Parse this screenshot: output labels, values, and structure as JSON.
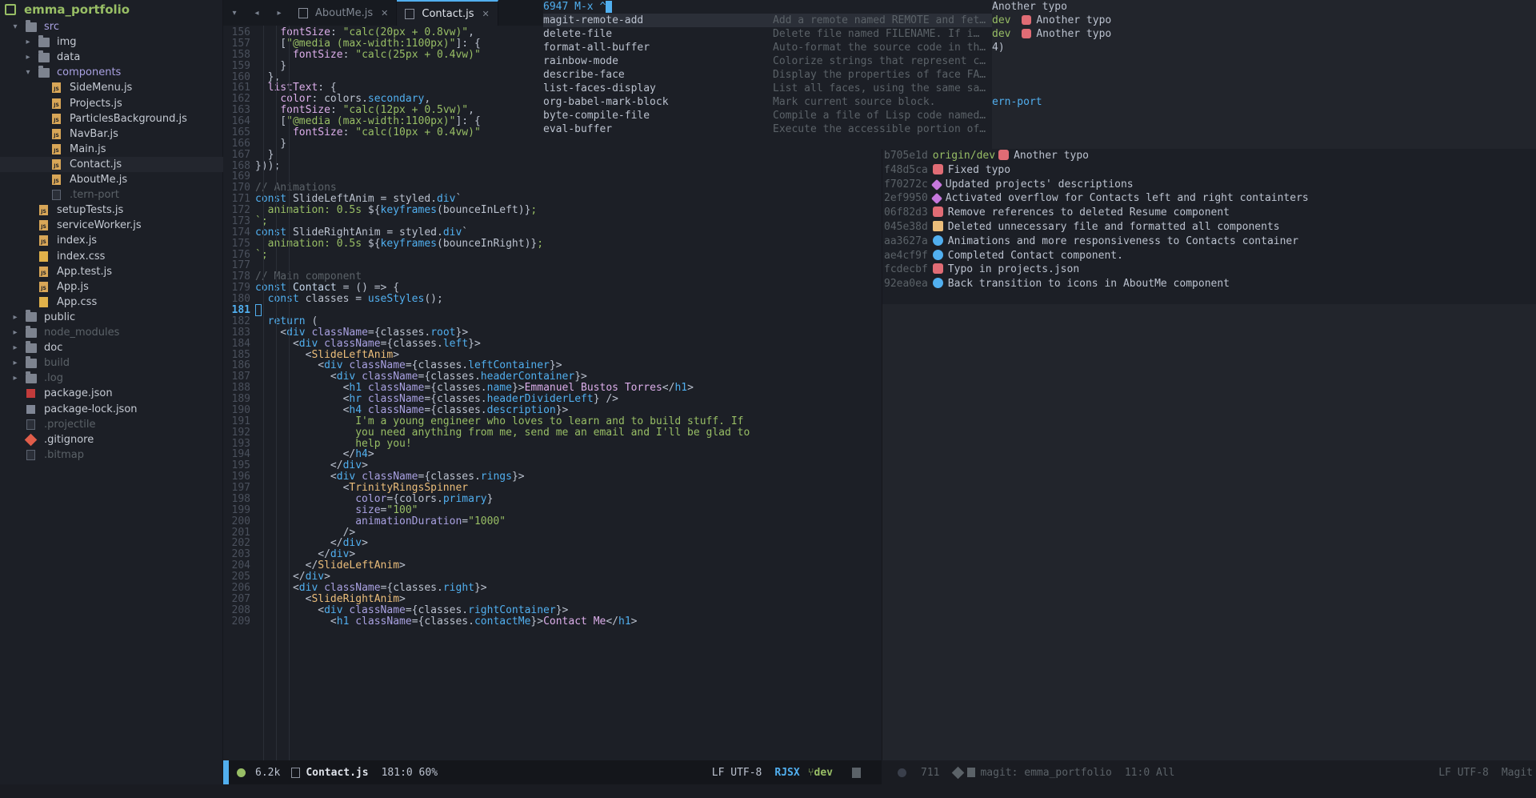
{
  "sidebar": {
    "project": "emma_portfolio",
    "items": [
      {
        "label": "src",
        "kind": "folder-open",
        "depth": 0,
        "color": "#a9a1e1"
      },
      {
        "label": "img",
        "kind": "folder",
        "depth": 1,
        "color": "#c5cad3"
      },
      {
        "label": "data",
        "kind": "folder",
        "depth": 1,
        "color": "#c5cad3"
      },
      {
        "label": "components",
        "kind": "folder-open",
        "depth": 1,
        "color": "#a9a1e1"
      },
      {
        "label": "SideMenu.js",
        "kind": "js",
        "depth": 2,
        "color": "#c5cad3"
      },
      {
        "label": "Projects.js",
        "kind": "js",
        "depth": 2,
        "color": "#c5cad3"
      },
      {
        "label": "ParticlesBackground.js",
        "kind": "js",
        "depth": 2,
        "color": "#c5cad3"
      },
      {
        "label": "NavBar.js",
        "kind": "js",
        "depth": 2,
        "color": "#c5cad3"
      },
      {
        "label": "Main.js",
        "kind": "js",
        "depth": 2,
        "color": "#c5cad3"
      },
      {
        "label": "Contact.js",
        "kind": "js",
        "depth": 2,
        "color": "#c5cad3",
        "selected": true
      },
      {
        "label": "AboutMe.js",
        "kind": "js",
        "depth": 2,
        "color": "#c5cad3"
      },
      {
        "label": ".tern-port",
        "kind": "doc",
        "depth": 2,
        "color": "#5b6268"
      },
      {
        "label": "setupTests.js",
        "kind": "js",
        "depth": 1,
        "color": "#c5cad3"
      },
      {
        "label": "serviceWorker.js",
        "kind": "js",
        "depth": 1,
        "color": "#c5cad3"
      },
      {
        "label": "index.js",
        "kind": "js",
        "depth": 1,
        "color": "#c5cad3"
      },
      {
        "label": "index.css",
        "kind": "css",
        "depth": 1,
        "color": "#c5cad3"
      },
      {
        "label": "App.test.js",
        "kind": "js",
        "depth": 1,
        "color": "#c5cad3"
      },
      {
        "label": "App.js",
        "kind": "js",
        "depth": 1,
        "color": "#c5cad3"
      },
      {
        "label": "App.css",
        "kind": "css",
        "depth": 1,
        "color": "#c5cad3"
      },
      {
        "label": "public",
        "kind": "folder",
        "depth": 0,
        "color": "#c5cad3"
      },
      {
        "label": "node_modules",
        "kind": "folder",
        "depth": 0,
        "color": "#5b6268"
      },
      {
        "label": "doc",
        "kind": "folder",
        "depth": 0,
        "color": "#c5cad3"
      },
      {
        "label": "build",
        "kind": "folder",
        "depth": 0,
        "color": "#5b6268"
      },
      {
        "label": ".log",
        "kind": "folder",
        "depth": 0,
        "color": "#5b6268"
      },
      {
        "label": "package.json",
        "kind": "npm",
        "depth": 0,
        "color": "#c5cad3"
      },
      {
        "label": "package-lock.json",
        "kind": "lock",
        "depth": 0,
        "color": "#c5cad3"
      },
      {
        "label": ".projectile",
        "kind": "doc",
        "depth": 0,
        "color": "#5b6268"
      },
      {
        "label": ".gitignore",
        "kind": "git",
        "depth": 0,
        "color": "#c5cad3"
      },
      {
        "label": ".bitmap",
        "kind": "doc",
        "depth": 0,
        "color": "#5b6268"
      }
    ]
  },
  "tabs": [
    {
      "label": "AboutMe.js",
      "active": false
    },
    {
      "label": "Contact.js",
      "active": true
    }
  ],
  "code": {
    "current_line": 181,
    "lines": [
      {
        "n": 156,
        "html": "    <span class='v'>fontSize</span>: <span class='s'>\"calc(20px + 0.8vw)\"</span>,"
      },
      {
        "n": 157,
        "html": "    [<span class='s'>\"@media (max-width:1100px)\"</span>]: {"
      },
      {
        "n": 158,
        "html": "      <span class='v'>fontSize</span>: <span class='s'>\"calc(25px + 0.4vw)\"</span>"
      },
      {
        "n": 159,
        "html": "    }"
      },
      {
        "n": 160,
        "html": "  },"
      },
      {
        "n": 161,
        "html": "  <span class='v'>listText</span>: {"
      },
      {
        "n": 162,
        "html": "    <span class='v'>color</span>: colors.<span class='k'>secondary</span>,"
      },
      {
        "n": 163,
        "html": "    <span class='v'>fontSize</span>: <span class='s'>\"calc(12px + 0.5vw)\"</span>,"
      },
      {
        "n": 164,
        "html": "    [<span class='s'>\"@media (max-width:1100px)\"</span>]: {"
      },
      {
        "n": 165,
        "html": "      <span class='v'>fontSize</span>: <span class='s'>\"calc(10px + 0.4vw)\"</span>"
      },
      {
        "n": 166,
        "html": "    }"
      },
      {
        "n": 167,
        "html": "  }"
      },
      {
        "n": 168,
        "html": "}));"
      },
      {
        "n": 169,
        "html": ""
      },
      {
        "n": 170,
        "html": "<span class='c'>// Animations</span>"
      },
      {
        "n": 171,
        "html": "<span class='k'>const</span> SlideLeftAnim = styled.<span class='k'>div</span>`"
      },
      {
        "n": 172,
        "html": "<span class='s'>  animation: 0.5s </span>${<span class='k'>keyframes</span>(bounceInLeft)}<span class='s'>;</span>"
      },
      {
        "n": 173,
        "html": "<span class='s'>`;</span>"
      },
      {
        "n": 174,
        "html": "<span class='k'>const</span> SlideRightAnim = styled.<span class='k'>div</span>`"
      },
      {
        "n": 175,
        "html": "<span class='s'>  animation: 0.5s </span>${<span class='k'>keyframes</span>(bounceInRight)}<span class='s'>;</span>"
      },
      {
        "n": 176,
        "html": "<span class='s'>`;</span>"
      },
      {
        "n": 177,
        "html": ""
      },
      {
        "n": 178,
        "html": "<span class='c'>// Main component</span>"
      },
      {
        "n": 179,
        "html": "<span class='k'>const</span> <span class='f'>Contact</span> = () =&gt; {"
      },
      {
        "n": 180,
        "html": "  <span class='k'>const</span> classes = <span class='k'>useStyles</span>();"
      },
      {
        "n": 181,
        "html": "<span class='cursor-box'></span>",
        "current": true
      },
      {
        "n": 182,
        "html": "  <span class='k'>return</span> ("
      },
      {
        "n": 183,
        "html": "    &lt;<span class='tag'>div</span> <span class='attr'>className</span>={classes.<span class='k'>root</span>}&gt;"
      },
      {
        "n": 184,
        "html": "      &lt;<span class='tag'>div</span> <span class='attr'>className</span>={classes.<span class='k'>left</span>}&gt;"
      },
      {
        "n": 185,
        "html": "        &lt;<span class='t'>SlideLeftAnim</span>&gt;"
      },
      {
        "n": 186,
        "html": "          &lt;<span class='tag'>div</span> <span class='attr'>className</span>={classes.<span class='k'>leftContainer</span>}&gt;"
      },
      {
        "n": 187,
        "html": "            &lt;<span class='tag'>div</span> <span class='attr'>className</span>={classes.<span class='k'>headerContainer</span>}&gt;"
      },
      {
        "n": 188,
        "html": "              &lt;<span class='tag'>h1</span> <span class='attr'>className</span>={classes.<span class='k'>name</span>}&gt;<span class='v'>Emmanuel Bustos Torres</span>&lt;/<span class='tag'>h1</span>&gt;"
      },
      {
        "n": 189,
        "html": "              &lt;<span class='tag'>hr</span> <span class='attr'>className</span>={classes.<span class='k'>headerDividerLeft</span>} /&gt;"
      },
      {
        "n": 190,
        "html": "              &lt;<span class='tag'>h4</span> <span class='attr'>className</span>={classes.<span class='k'>description</span>}&gt;"
      },
      {
        "n": 191,
        "html": "                <span class='s'>I'm a young engineer who loves to learn and to build stuff. If</span>"
      },
      {
        "n": 192,
        "html": "                <span class='s'>you need anything from me, send me an email and I'll be glad to</span>"
      },
      {
        "n": 193,
        "html": "                <span class='s'>help you!</span>"
      },
      {
        "n": 194,
        "html": "              &lt;/<span class='tag'>h4</span>&gt;"
      },
      {
        "n": 195,
        "html": "            &lt;/<span class='tag'>div</span>&gt;"
      },
      {
        "n": 196,
        "html": "            &lt;<span class='tag'>div</span> <span class='attr'>className</span>={classes.<span class='k'>rings</span>}&gt;"
      },
      {
        "n": 197,
        "html": "              &lt;<span class='t'>TrinityRingsSpinner</span>"
      },
      {
        "n": 198,
        "html": "                <span class='attr'>color</span>={colors.<span class='k'>primary</span>}"
      },
      {
        "n": 199,
        "html": "                <span class='attr'>size</span>=<span class='s'>\"100\"</span>"
      },
      {
        "n": 200,
        "html": "                <span class='attr'>animationDuration</span>=<span class='s'>\"1000\"</span>"
      },
      {
        "n": 201,
        "html": "              /&gt;"
      },
      {
        "n": 202,
        "html": "            &lt;/<span class='tag'>div</span>&gt;"
      },
      {
        "n": 203,
        "html": "          &lt;/<span class='tag'>div</span>&gt;"
      },
      {
        "n": 204,
        "html": "        &lt;/<span class='t'>SlideLeftAnim</span>&gt;"
      },
      {
        "n": 205,
        "html": "      &lt;/<span class='tag'>div</span>&gt;"
      },
      {
        "n": 206,
        "html": "      &lt;<span class='tag'>div</span> <span class='attr'>className</span>={classes.<span class='k'>right</span>}&gt;"
      },
      {
        "n": 207,
        "html": "        &lt;<span class='t'>SlideRightAnim</span>&gt;"
      },
      {
        "n": 208,
        "html": "          &lt;<span class='tag'>div</span> <span class='attr'>className</span>={classes.<span class='k'>rightContainer</span>}&gt;"
      },
      {
        "n": 209,
        "html": "            &lt;<span class='tag'>h1</span> <span class='attr'>className</span>={classes.<span class='k'>contactMe</span>}&gt;<span class='v'>Contact Me</span>&lt;/<span class='tag'>h1</span>&gt;"
      }
    ]
  },
  "modeline_left": {
    "size": "6.2k",
    "filename": "Contact.js",
    "position": "181:0 60%",
    "encoding": "LF UTF-8",
    "mode": "RJSX",
    "branch": "dev"
  },
  "mx": {
    "prompt": "6947 M-x ^",
    "candidates": [
      {
        "name": "magit-remote-add",
        "doc": "Add a remote named REMOTE and fet…",
        "selected": true
      },
      {
        "name": "delete-file",
        "doc": "Delete file named FILENAME.  If i…"
      },
      {
        "name": "format-all-buffer",
        "doc": "Auto-format the source code in th…"
      },
      {
        "name": "rainbow-mode",
        "doc": "Colorize strings that represent c…"
      },
      {
        "name": "describe-face",
        "doc": "Display the properties of face FA…"
      },
      {
        "name": "list-faces-display",
        "doc": "List all faces, using the same sa…"
      },
      {
        "name": "org-babel-mark-block",
        "doc": "Mark current source block."
      },
      {
        "name": "byte-compile-file",
        "doc": "Compile a file of Lisp code named…"
      },
      {
        "name": "eval-buffer",
        "doc": "Execute the accessible portion of…"
      }
    ]
  },
  "magit_top": [
    "Another typo",
    "dev|Another typo",
    "dev|Another typo",
    "4)",
    "",
    "",
    "",
    "ern-port"
  ],
  "magit_log": [
    {
      "hash": "b705e1d",
      "ref": "origin/dev",
      "icon": "bug",
      "msg": "Another typo"
    },
    {
      "hash": "f48d5ca",
      "icon": "bug",
      "msg": "Fixed typo"
    },
    {
      "hash": "f70272c",
      "icon": "wrench",
      "msg": "Updated projects' descriptions"
    },
    {
      "hash": "2ef9950",
      "icon": "wrench",
      "msg": "Activated overflow for Contacts left and right containters"
    },
    {
      "hash": "06f82d3",
      "icon": "bug",
      "msg": "Remove references to deleted Resume component"
    },
    {
      "hash": "045e38d",
      "icon": "scissors",
      "msg": "Deleted unnecessary file and formatted all components"
    },
    {
      "hash": "aa3627a",
      "icon": "plus",
      "msg": "Animations and more responsiveness to Contacts container"
    },
    {
      "hash": "ae4cf9f",
      "icon": "plus",
      "msg": "Completed Contact component."
    },
    {
      "hash": "fcdecbf",
      "icon": "bug",
      "msg": "Typo in projects.json"
    },
    {
      "hash": "92ea0ea",
      "icon": "plus",
      "msg": "Back transition to icons in AboutMe component"
    }
  ],
  "modeline_right": {
    "size": "711",
    "buffer": "magit: emma_portfolio",
    "position": "11:0 All",
    "encoding": "LF UTF-8",
    "mode": "Magit"
  }
}
